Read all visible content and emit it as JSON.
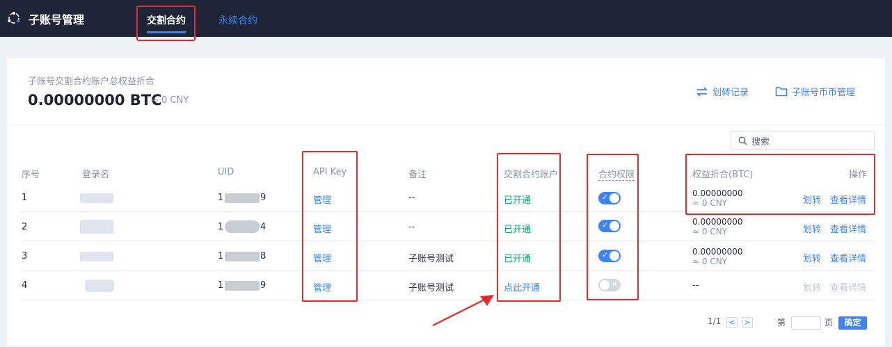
{
  "nav": {
    "brand": "子账号管理",
    "tabs": [
      {
        "label": "交割合约",
        "active": true
      },
      {
        "label": "永续合约",
        "active": false
      }
    ]
  },
  "summary": {
    "label": "子账号交割合约账户总权益折合",
    "value": "0.00000000 BTC",
    "approx": "≈ 0 CNY",
    "transfer_link": "划转记录",
    "manage_link": "子账号币币管理"
  },
  "search": {
    "placeholder": "搜索"
  },
  "table": {
    "headers": {
      "seq": "序号",
      "login": "登录名",
      "uid": "UID",
      "apikey": "API Key",
      "remark": "备注",
      "account": "交割合约账户",
      "permission": "合约权限",
      "equity": "权益折合(BTC)",
      "action": "操作"
    },
    "rows": [
      {
        "seq": "1",
        "uid_prefix": "1",
        "uid_suffix": "9",
        "apikey": "管理",
        "remark": "--",
        "account": "已开通",
        "permission": true,
        "equity": "0.00000000",
        "equity_cny": "≈ 0 CNY",
        "transfer": "划转",
        "detail": "查看详情"
      },
      {
        "seq": "2",
        "uid_prefix": "1",
        "uid_suffix": "4",
        "apikey": "管理",
        "remark": "--",
        "account": "已开通",
        "permission": true,
        "equity": "0.00000000",
        "equity_cny": "≈ 0 CNY",
        "transfer": "划转",
        "detail": "查看详情"
      },
      {
        "seq": "3",
        "uid_prefix": "1",
        "uid_suffix": "8",
        "apikey": "管理",
        "remark": "子账号测试",
        "account": "已开通",
        "permission": true,
        "equity": "0.00000000",
        "equity_cny": "≈ 0 CNY",
        "transfer": "划转",
        "detail": "查看详情"
      },
      {
        "seq": "4",
        "uid_prefix": "1",
        "uid_suffix": "9",
        "apikey": "管理",
        "remark": "子账号测试",
        "account": "点此开通",
        "permission": false,
        "equity": "--",
        "equity_cny": "",
        "transfer": "划转",
        "detail": "查看详情"
      }
    ]
  },
  "pagination": {
    "page_info": "1/1",
    "prev": "<",
    "next": ">",
    "page_label": "第",
    "page_unit": "页",
    "confirm": "确定"
  },
  "colors": {
    "accent": "#3b83ff",
    "nav_bg": "#1d2536",
    "success": "#10a76b",
    "annotation": "#e52b2b"
  }
}
